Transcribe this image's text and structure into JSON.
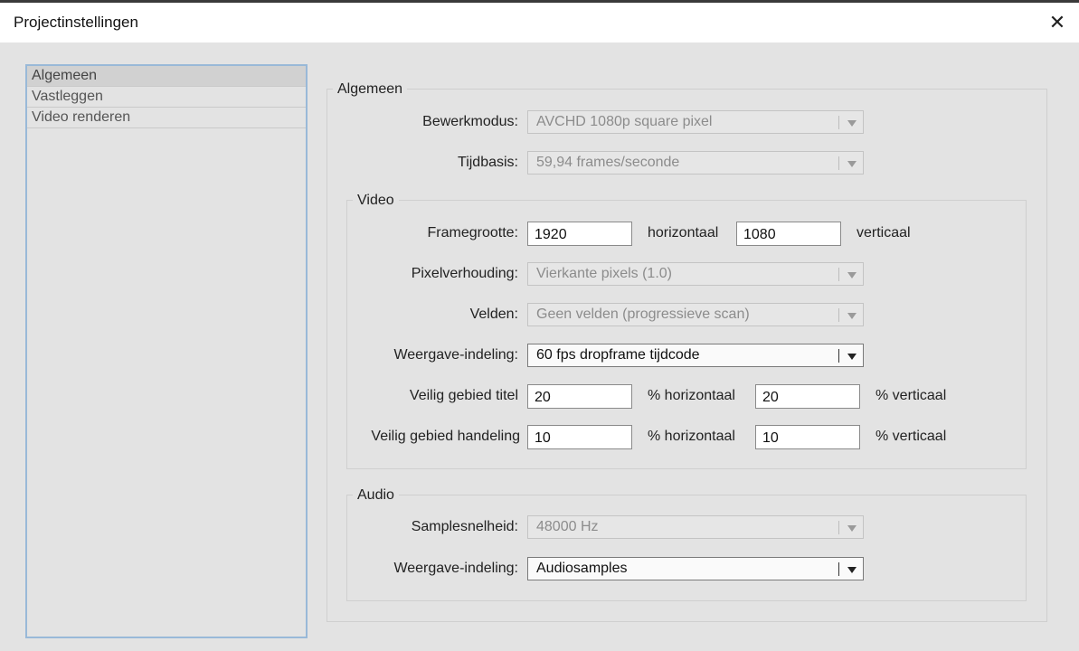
{
  "window": {
    "title": "Projectinstellingen"
  },
  "sidebar": {
    "items": [
      {
        "label": "Algemeen"
      },
      {
        "label": "Vastleggen"
      },
      {
        "label": "Video renderen"
      }
    ]
  },
  "general": {
    "title": "Algemeen",
    "edit_mode": {
      "label": "Bewerkmodus:",
      "value": "AVCHD 1080p square pixel"
    },
    "timebase": {
      "label": "Tijdbasis:",
      "value": "59,94 frames/seconde"
    }
  },
  "video": {
    "title": "Video",
    "frame_size": {
      "label": "Framegrootte:",
      "horizontal": "1920",
      "horizontal_unit": "horizontaal",
      "vertical": "1080",
      "vertical_unit": "verticaal"
    },
    "pixel_aspect": {
      "label": "Pixelverhouding:",
      "value": "Vierkante pixels (1.0)"
    },
    "fields": {
      "label": "Velden:",
      "value": "Geen velden (progressieve scan)"
    },
    "display_format": {
      "label": "Weergave-indeling:",
      "value": "60 fps dropframe tijdcode"
    },
    "title_safe": {
      "label": "Veilig gebied titel",
      "horizontal": "20",
      "horizontal_unit": "% horizontaal",
      "vertical": "20",
      "vertical_unit": "% verticaal"
    },
    "action_safe": {
      "label": "Veilig gebied handeling",
      "horizontal": "10",
      "horizontal_unit": "% horizontaal",
      "vertical": "10",
      "vertical_unit": "% verticaal"
    }
  },
  "audio": {
    "title": "Audio",
    "sample_rate": {
      "label": "Samplesnelheid:",
      "value": "48000 Hz"
    },
    "display_format": {
      "label": "Weergave-indeling:",
      "value": "Audiosamples"
    }
  }
}
